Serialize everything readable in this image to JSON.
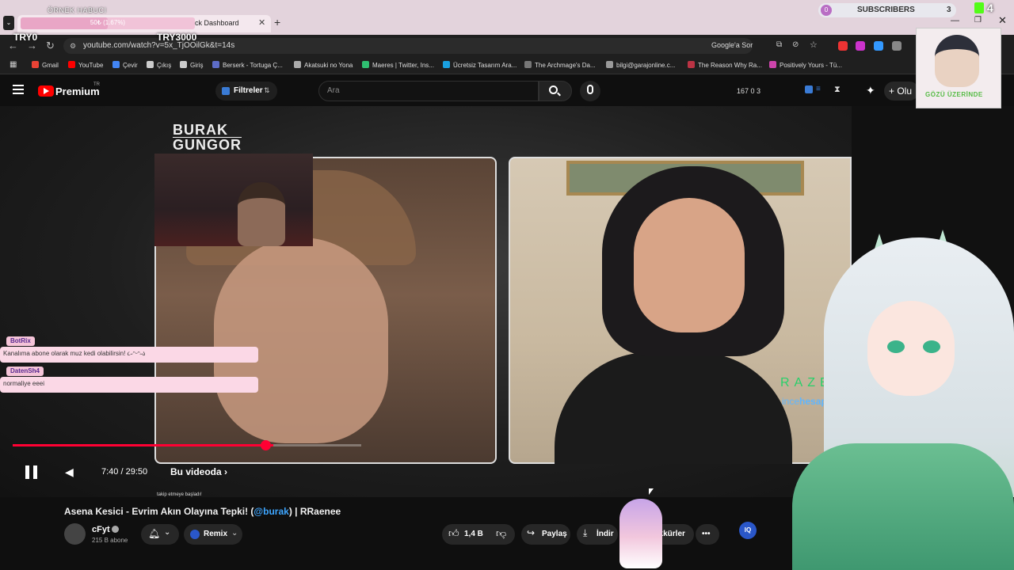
{
  "browser": {
    "tab_title": "ck Dashboard",
    "goal_label": "ÖRNEK HABUCI",
    "progress_text": "50₺ (1.67%)",
    "progress_fraction": 0.0167,
    "url": "youtube.com/watch?v=5x_TjOOilGk&t=14s",
    "google_ask": "Google'a Sor",
    "bookmarks": [
      "Gmail",
      "YouTube",
      "Çevir",
      "Çıkış",
      "Giriş",
      "Berserk - Tortuga Ç...",
      "Akatsuki no Yona",
      "Maeres | Twitter, Ins...",
      "Ücretsiz Tasarım Ara...",
      "The Archmage's Da...",
      "bilgi@garajonline.c...",
      "The Reason Why Ra...",
      "Positively Yours - Tü..."
    ]
  },
  "overlay": {
    "try0": "TRY0",
    "try3000": "TRY3000",
    "subs_left_count": "0",
    "subs_label": "SUBSCRIBERS",
    "subs_count": "3",
    "k_count": "4",
    "avatar_caption": "GÖZÜ ÜZERİNDE",
    "chat": [
      {
        "user": "BotRix",
        "message": "Kanalıma abone olarak muz kedi olabilirsin! ૮˶ᵔᵕᵔ˶ა"
      },
      {
        "user": "DatenSh4",
        "message": "normaliye eeei"
      }
    ],
    "mini_chat": [
      "takip etmeye başladı!"
    ]
  },
  "youtube": {
    "premium": "Premium",
    "premium_sup": "TR",
    "filters_label": "Filtreler",
    "search_placeholder": "Ara",
    "stats": "167  0  3",
    "create_label": "+ Olu",
    "video_logo_line1": "BURAK",
    "video_logo_line2": "GUNGOR",
    "sponsor_name": "RAZER",
    "sponsor_sub_prefix": "ince",
    "sponsor_sub_suffix": "hesap",
    "time": "7:40 / 29:50",
    "playback_fraction": 0.257,
    "chapter": "Bu videoda",
    "title_prefix": "Asena Kesici - Evrim Akın Olayına Tepki! (",
    "title_mention": "@burak",
    "title_suffix": ") | RRaenee",
    "channel_name": "cFyt",
    "channel_subs": "215 B abone",
    "remix_label": "Remix",
    "like_count": "1,4 B",
    "share_label": "Paylaş",
    "download_label": "İndir",
    "thanks_label": "ekkürler",
    "more_label": "•••",
    "iq_label": "IQ"
  }
}
